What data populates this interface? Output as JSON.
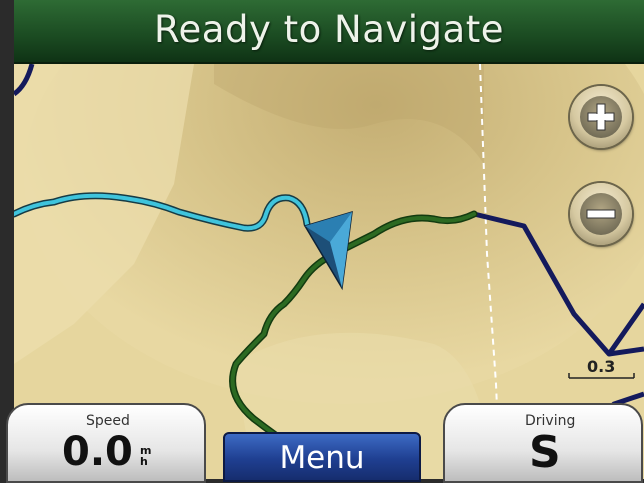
{
  "header": {
    "title": "Ready to Navigate"
  },
  "map": {
    "zoom_in_icon": "plus-icon",
    "zoom_out_icon": "minus-icon",
    "scale_label": "0.3",
    "colors": {
      "terrain": "#e6d69e",
      "water_route": "#3fc4dc",
      "trail": "#1f5a1c",
      "road": "#141a5c"
    }
  },
  "fields": {
    "speed": {
      "label": "Speed",
      "value": "0.0",
      "unit_top": "m",
      "unit_bottom": "h"
    },
    "driving": {
      "label": "Driving",
      "value": "S"
    }
  },
  "menu": {
    "label": "Menu"
  },
  "colors": {
    "title_bar": "#1c4d23",
    "menu_button": "#1f3f91"
  }
}
